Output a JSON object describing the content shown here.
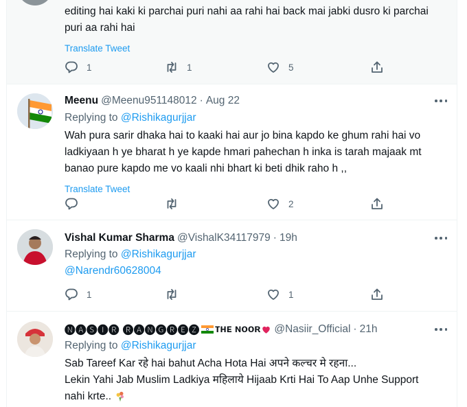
{
  "tweets": [
    {
      "text": "editing hai kaki ki parchai puri nahi aa rahi hai back mai jabki dusro ki parchai puri aa rahi hai",
      "translate": "Translate Tweet",
      "replies": "1",
      "retweets": "1",
      "likes": "5"
    },
    {
      "name": "Meenu",
      "handle": "@Meenu951148012",
      "separator": "·",
      "time": "Aug 22",
      "replying_label": "Replying to",
      "replying_to": "@Rishikagurjjar",
      "text": "Wah pura sarir dhaka hai to kaaki hai aur jo bina kapdo ke ghum rahi hai vo ladkiyaan h ye bharat h ye kapde hmari pahechan h inka is tarah majaak mt banao pure kapdo me vo kaali nhi bhart ki beti dhik raho h ,,",
      "translate": "Translate Tweet",
      "replies": "",
      "retweets": "",
      "likes": "2"
    },
    {
      "name": "Vishal Kumar Sharma",
      "handle": "@VishalK34117979",
      "separator": "·",
      "time": "19h",
      "replying_label": "Replying to",
      "replying_to": "@Rishikagurjjar",
      "replying_to_2": "@Narendr60628004",
      "replies": "1",
      "retweets": "",
      "likes": "1"
    },
    {
      "name": "🅝🅐🅢🅘🅡 🅡🅐🅝🅖🅡🅔🅩",
      "name_suffix": "ᴛʜᴇ ɴᴏᴏʀ",
      "handle": "@Nasiir_Official",
      "separator": "·",
      "time": "21h",
      "replying_label": "Replying to",
      "replying_to": "@Rishikagurjjar",
      "line1": "Sab Tareef Kar रहे hai bahut Acha Hota Hai अपने कल्चर मे रहना...",
      "line2": "Lekin Yahi Jab Muslim Ladkiya महिलाये Hijaab Krti Hai To Aap Unhe Support",
      "line3": "nahi krte.."
    }
  ],
  "colors": {
    "link": "#1d9bf0",
    "secondary_text": "#536471",
    "border": "#eff3f4",
    "highlight_bg": "#f7f9f9"
  },
  "icons": [
    "reply-icon",
    "retweet-icon",
    "like-icon",
    "share-icon",
    "more-icon",
    "india-flag-icon",
    "heart-emoji-icon",
    "bouquet-emoji-icon"
  ]
}
